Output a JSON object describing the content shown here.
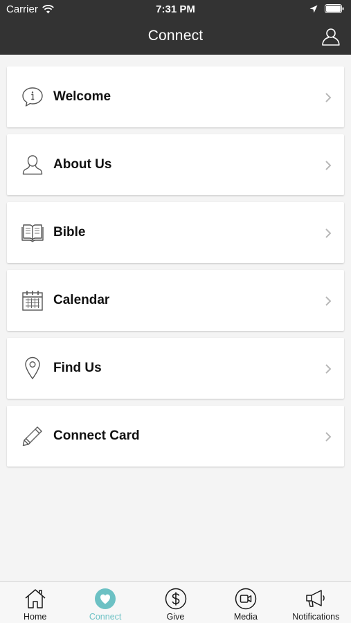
{
  "status_bar": {
    "carrier": "Carrier",
    "time": "7:31 PM"
  },
  "header": {
    "title": "Connect",
    "profile_icon": "person-outline-icon"
  },
  "menu": [
    {
      "label": "Welcome",
      "icon": "info-bubble-icon"
    },
    {
      "label": "About Us",
      "icon": "person-icon"
    },
    {
      "label": "Bible",
      "icon": "open-book-icon"
    },
    {
      "label": "Calendar",
      "icon": "calendar-icon"
    },
    {
      "label": "Find Us",
      "icon": "map-pin-icon"
    },
    {
      "label": "Connect Card",
      "icon": "pencil-icon"
    }
  ],
  "tabs": [
    {
      "label": "Home",
      "icon": "home-icon",
      "active": false
    },
    {
      "label": "Connect",
      "icon": "heart-icon",
      "active": true
    },
    {
      "label": "Give",
      "icon": "dollar-icon",
      "active": false
    },
    {
      "label": "Media",
      "icon": "video-icon",
      "active": false
    },
    {
      "label": "Notifications",
      "icon": "megaphone-icon",
      "active": false
    }
  ],
  "colors": {
    "header_bg": "#333333",
    "accent": "#6cc1c4",
    "background": "#f4f4f4"
  }
}
